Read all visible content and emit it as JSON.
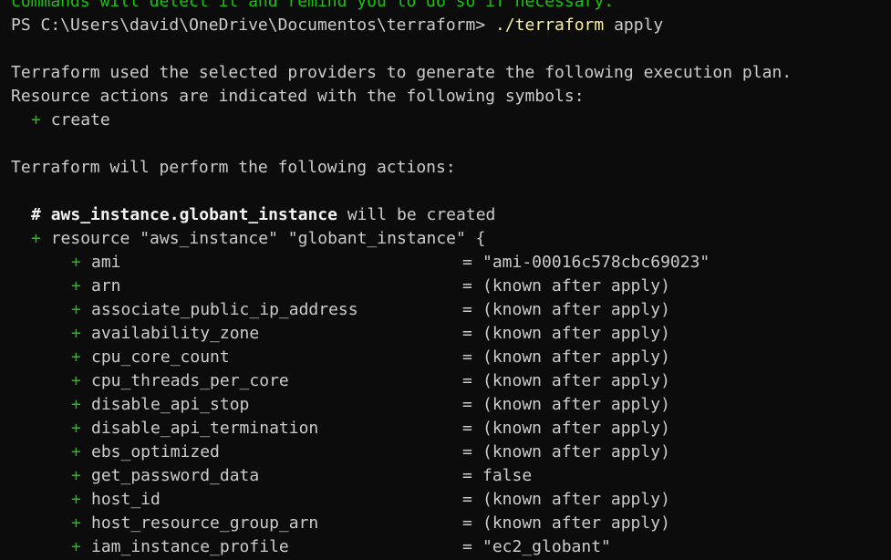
{
  "terminal": {
    "colors": {
      "background": "#0c0c0c",
      "foreground": "#cccccc",
      "green": "#16c60c",
      "yellow": "#f9f1a5"
    },
    "prev_line": "commands will detect it and remind you to do so if necessary.",
    "prompt": {
      "path": "PS C:\\Users\\david\\OneDrive\\Documentos\\terraform>",
      "command": "./terraform",
      "args": "apply"
    },
    "plan_intro_1": "Terraform used the selected providers to generate the following execution plan.",
    "plan_intro_2": "Resource actions are indicated with the following symbols:",
    "create_symbol": "+",
    "create_label": "create",
    "actions_header": "Terraform will perform the following actions:",
    "resource_comment_hash": "#",
    "resource_address": "aws_instance.globant_instance",
    "resource_comment_suffix": "will be created",
    "resource_decl": "resource \"aws_instance\" \"globant_instance\" {",
    "attributes": [
      {
        "symbol": "+",
        "name": "ami",
        "eq": "=",
        "value": "\"ami-00016c578cbc69023\""
      },
      {
        "symbol": "+",
        "name": "arn",
        "eq": "=",
        "value": "(known after apply)"
      },
      {
        "symbol": "+",
        "name": "associate_public_ip_address",
        "eq": "=",
        "value": "(known after apply)"
      },
      {
        "symbol": "+",
        "name": "availability_zone",
        "eq": "=",
        "value": "(known after apply)"
      },
      {
        "symbol": "+",
        "name": "cpu_core_count",
        "eq": "=",
        "value": "(known after apply)"
      },
      {
        "symbol": "+",
        "name": "cpu_threads_per_core",
        "eq": "=",
        "value": "(known after apply)"
      },
      {
        "symbol": "+",
        "name": "disable_api_stop",
        "eq": "=",
        "value": "(known after apply)"
      },
      {
        "symbol": "+",
        "name": "disable_api_termination",
        "eq": "=",
        "value": "(known after apply)"
      },
      {
        "symbol": "+",
        "name": "ebs_optimized",
        "eq": "=",
        "value": "(known after apply)"
      },
      {
        "symbol": "+",
        "name": "get_password_data",
        "eq": "=",
        "value": "false"
      },
      {
        "symbol": "+",
        "name": "host_id",
        "eq": "=",
        "value": "(known after apply)"
      },
      {
        "symbol": "+",
        "name": "host_resource_group_arn",
        "eq": "=",
        "value": "(known after apply)"
      },
      {
        "symbol": "+",
        "name": "iam_instance_profile",
        "eq": "=",
        "value": "\"ec2_globant\""
      }
    ]
  }
}
